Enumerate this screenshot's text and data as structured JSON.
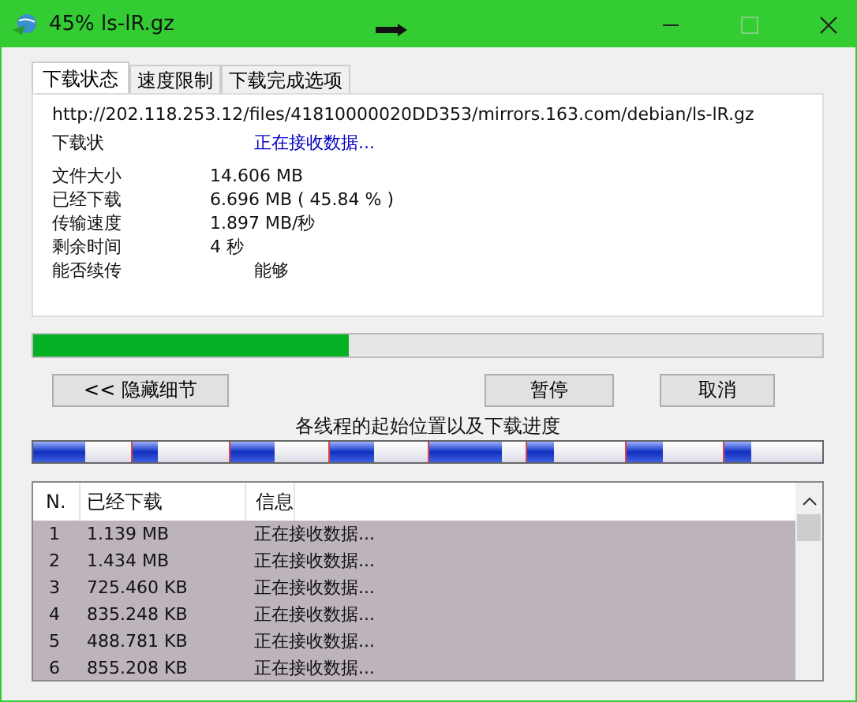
{
  "window": {
    "title": "45% ls-lR.gz"
  },
  "tabs": [
    {
      "label": "下载状态",
      "selected": true
    },
    {
      "label": "速度限制",
      "selected": false
    },
    {
      "label": "下载完成选项",
      "selected": false
    }
  ],
  "url": "http://202.118.253.12/files/41810000020DD353/mirrors.163.com/debian/ls-lR.gz",
  "status": {
    "label": "下载状",
    "value": "正在接收数据..."
  },
  "details": [
    {
      "label": "文件大小",
      "value": "14.606  MB",
      "indent": false
    },
    {
      "label": "已经下载",
      "value": "6.696  MB ( 45.84 % )",
      "indent": false
    },
    {
      "label": "传输速度",
      "value": "1.897  MB/秒",
      "indent": false
    },
    {
      "label": "剩余时间",
      "value": "4 秒",
      "indent": false
    },
    {
      "label": "能否续传",
      "value": "能够",
      "indent": true
    }
  ],
  "progress": {
    "level": 0.4
  },
  "buttons": {
    "details": "<< 隐藏细节",
    "pause": "暂停",
    "cancel": "取消"
  },
  "threads_label": "各线程的起始位置以及下载进度",
  "threads": [
    {
      "level": 0.53
    },
    {
      "level": 0.26
    },
    {
      "level": 0.45
    },
    {
      "level": 0.46
    },
    {
      "level": 0.75
    },
    {
      "level": 0.28
    },
    {
      "level": 0.38
    },
    {
      "level": 0.27
    }
  ],
  "table": {
    "columns": [
      "N.",
      "已经下载",
      "信息"
    ],
    "rows": [
      {
        "cells": [
          "1",
          "1.139  MB",
          "正在接收数据..."
        ],
        "selected": true
      },
      {
        "cells": [
          "2",
          "1.434  MB",
          "正在接收数据..."
        ],
        "selected": true
      },
      {
        "cells": [
          "3",
          "725.460  KB",
          "正在接收数据..."
        ],
        "selected": true
      },
      {
        "cells": [
          "4",
          "835.248  KB",
          "正在接收数据..."
        ],
        "selected": true
      },
      {
        "cells": [
          "5",
          "488.781  KB",
          "正在接收数据..."
        ],
        "selected": true
      },
      {
        "cells": [
          "6",
          "855.208  KB",
          "正在接收数据..."
        ],
        "selected": true
      }
    ]
  }
}
